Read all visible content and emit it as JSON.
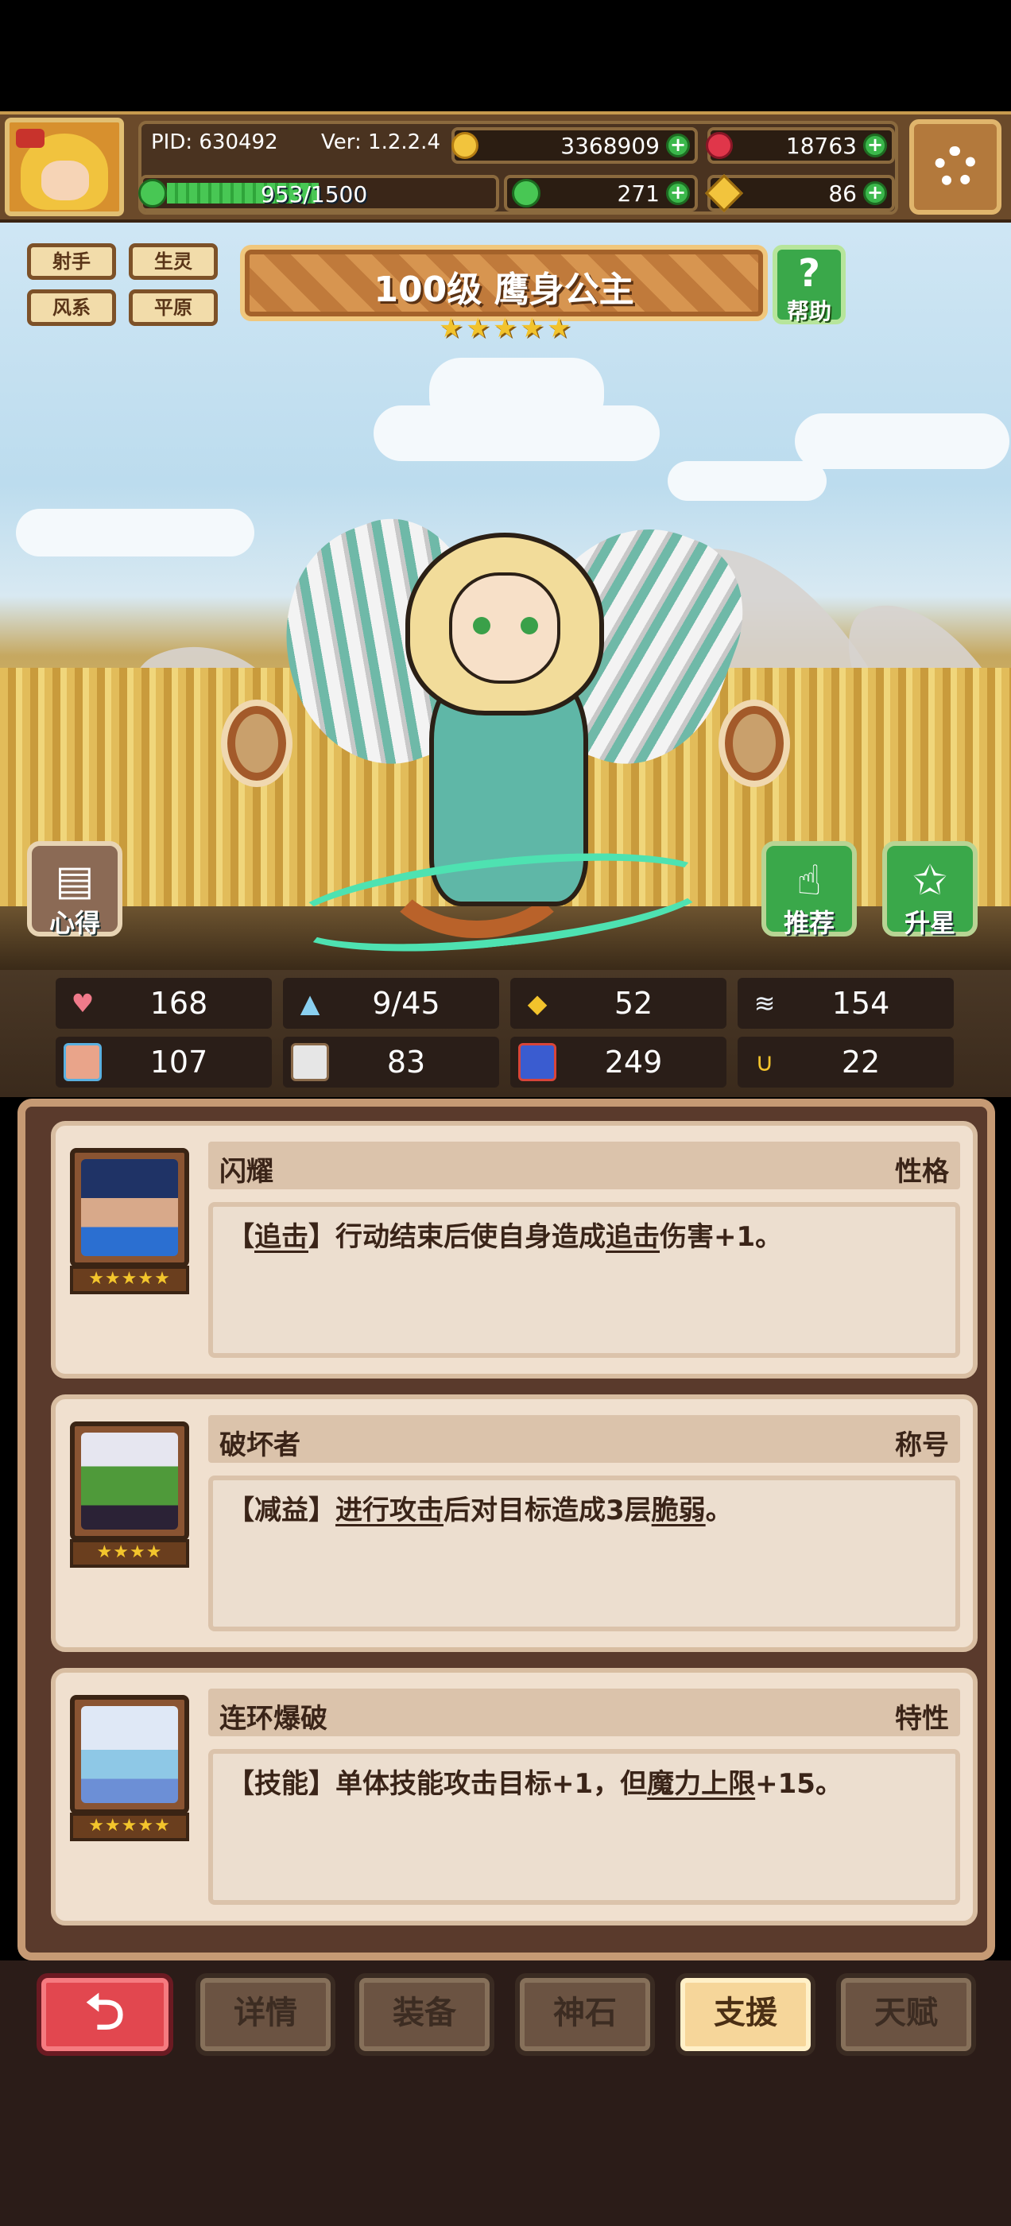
{
  "header": {
    "pid": "PID: 630492",
    "version": "Ver: 1.2.2.4",
    "gold": "3368909",
    "gems": "18763",
    "energy": "953/1500",
    "energy_fraction": 0.635,
    "clover": "271",
    "keys": "86"
  },
  "tags": [
    "射手",
    "生灵",
    "风系",
    "平原"
  ],
  "hero": {
    "title": "100级  鹰身公主",
    "stars": 5
  },
  "help_label": "帮助",
  "side_buttons": {
    "insight": "心得",
    "recommend": "推荐",
    "star_up": "升星"
  },
  "stats": [
    {
      "icon": "heart-icon",
      "value": "168"
    },
    {
      "icon": "mana-drop-icon",
      "value": "9/45"
    },
    {
      "icon": "shield-icon",
      "value": "52"
    },
    {
      "icon": "wing-speed-icon",
      "value": "154"
    },
    {
      "icon": "fist-icon",
      "value": "107"
    },
    {
      "icon": "book-icon",
      "value": "83"
    },
    {
      "icon": "stairs-icon",
      "value": "249"
    },
    {
      "icon": "horseshoe-icon",
      "value": "22"
    }
  ],
  "support_cards": [
    {
      "name": "闪耀",
      "type": "性格",
      "stars": "★★★★★",
      "desc": {
        "p1": "【",
        "k1": "追击",
        "p2": "】行动结束后使自身造成",
        "k2": "追击",
        "p3": "伤害+1。"
      }
    },
    {
      "name": "破坏者",
      "type": "称号",
      "stars": "★★★★",
      "desc": {
        "p1": "【减益】",
        "k1": "进行攻击",
        "p2": "后对目标造成3层",
        "k2": "脆弱",
        "p3": "。"
      }
    },
    {
      "name": "连环爆破",
      "type": "特性",
      "stars": "★★★★★",
      "desc": {
        "p1": "【技能】单体技能攻击目标+1，但",
        "k1": "魔力上限",
        "p2": "+15。",
        "k2": "",
        "p3": ""
      }
    }
  ],
  "nav": {
    "back": "⮌",
    "tabs": [
      "详情",
      "装备",
      "神石",
      "支援",
      "天赋"
    ],
    "active": "支援"
  }
}
